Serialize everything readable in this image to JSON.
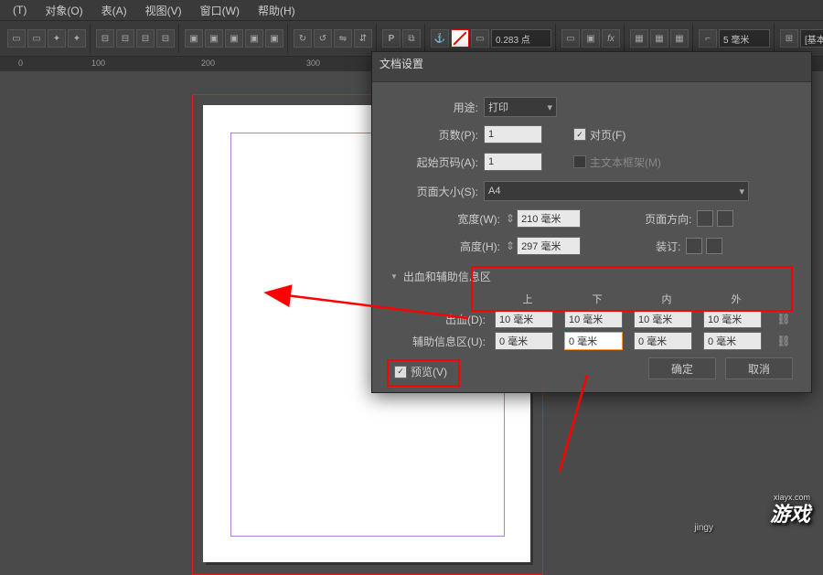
{
  "menubar": {
    "items": [
      "(T)",
      "对象(O)",
      "表(A)",
      "视图(V)",
      "窗口(W)",
      "帮助(H)"
    ]
  },
  "toolbar": {
    "stroke_value": "0.283 点",
    "zoom": "5 毫米",
    "style": "[基本图形框"
  },
  "ruler": {
    "marks": [
      "0",
      "100",
      "200",
      "300"
    ]
  },
  "dialog": {
    "title": "文档设置",
    "purpose": {
      "label": "用途:",
      "value": "打印"
    },
    "pages": {
      "label": "页数(P):",
      "value": "1"
    },
    "facing": {
      "label": "对页(F)",
      "checked": true
    },
    "start": {
      "label": "起始页码(A):",
      "value": "1"
    },
    "master": {
      "label": "主文本框架(M)",
      "checked": false
    },
    "size": {
      "label": "页面大小(S):",
      "value": "A4"
    },
    "width": {
      "label": "宽度(W):",
      "value": "210 毫米"
    },
    "height": {
      "label": "高度(H):",
      "value": "297 毫米"
    },
    "orient": {
      "label": "页面方向:"
    },
    "binding": {
      "label": "装订:"
    },
    "bleed_section": "出血和辅助信息区",
    "col_hdrs": {
      "top": "上",
      "bottom": "下",
      "inside": "内",
      "outside": "外"
    },
    "bleed": {
      "label": "出血(D):",
      "top": "10 毫米",
      "bottom": "10 毫米",
      "inside": "10 毫米",
      "outside": "10 毫米"
    },
    "slug": {
      "label": "辅助信息区(U):",
      "top": "0 毫米",
      "bottom": "0 毫米",
      "inside": "0 毫米",
      "outside": "0 毫米"
    },
    "preview": {
      "label": "预览(V)",
      "checked": true
    },
    "ok": "确定",
    "cancel": "取消"
  },
  "watermark": {
    "site": "xiayx.com",
    "brand": "游戏",
    "exp": "jingy"
  }
}
